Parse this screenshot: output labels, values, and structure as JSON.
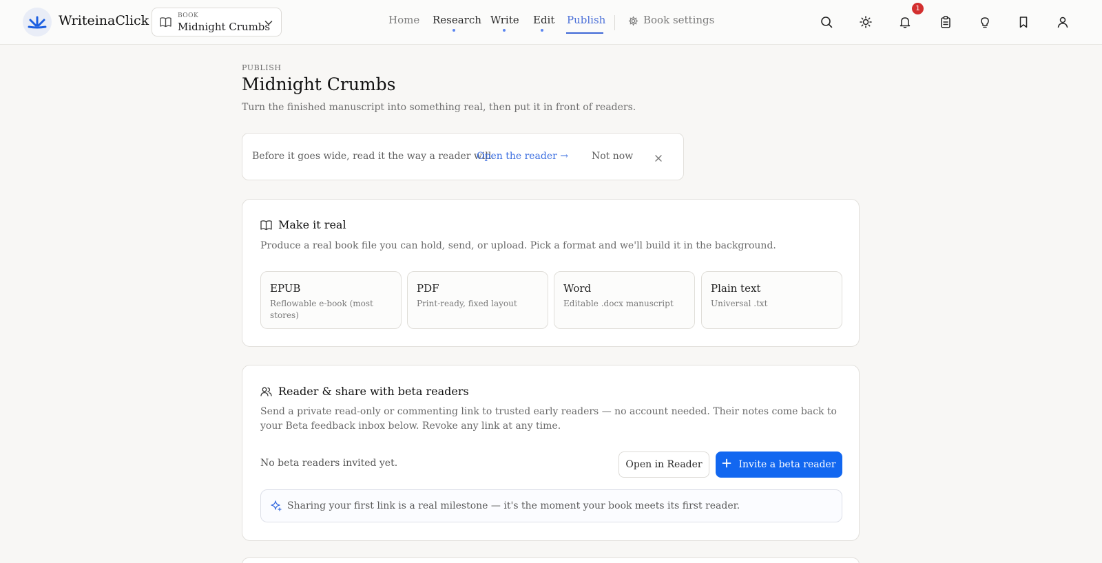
{
  "app": {
    "name": "WriteinaClick"
  },
  "book_picker": {
    "label": "BOOK",
    "title": "Midnight Crumbs"
  },
  "nav": {
    "items": [
      {
        "label": "Home",
        "state": "muted"
      },
      {
        "label": "Research",
        "state": "dot"
      },
      {
        "label": "Write",
        "state": "dot"
      },
      {
        "label": "Edit",
        "state": "dot"
      },
      {
        "label": "Publish",
        "state": "active"
      }
    ],
    "book_settings": "Book settings"
  },
  "toolbar": {
    "icons": [
      "search-icon",
      "theme-sun-icon",
      "bell-icon",
      "clipboard-icon",
      "lightbulb-icon",
      "bookmark-icon",
      "user-icon"
    ],
    "notification_count": "1"
  },
  "page": {
    "kicker": "PUBLISH",
    "title": "Midnight Crumbs",
    "subtitle": "Turn the finished manuscript into something real, then put it in front of readers."
  },
  "banner": {
    "text": "Before it goes wide, read it the way a reader will.",
    "link": "Open the reader →",
    "dismiss": "Not now"
  },
  "make_real": {
    "title": "Make it real",
    "description": "Produce a real book file you can hold, send, or upload. Pick a format and we'll build it in the background.",
    "formats": [
      {
        "name": "EPUB",
        "desc": "Reflowable e-book (most stores)"
      },
      {
        "name": "PDF",
        "desc": "Print-ready, fixed layout"
      },
      {
        "name": "Word",
        "desc": "Editable .docx manuscript"
      },
      {
        "name": "Plain text",
        "desc": "Universal .txt"
      }
    ]
  },
  "beta": {
    "title": "Reader & share with beta readers",
    "description": "Send a private read-only or commenting link to trusted early readers — no account needed. Their notes come back to your Beta feedback inbox below. Revoke any link at any time.",
    "empty": "No beta readers invited yet.",
    "open_reader": "Open in Reader",
    "invite": "Invite a beta reader",
    "milestone": "Sharing your first link is a real milestone — it's the moment your book meets its first reader."
  },
  "colors": {
    "accent": "#1267f0",
    "nav_active": "#4a6fd8",
    "badge": "#d32f2f",
    "background": "#f8f7f5"
  }
}
